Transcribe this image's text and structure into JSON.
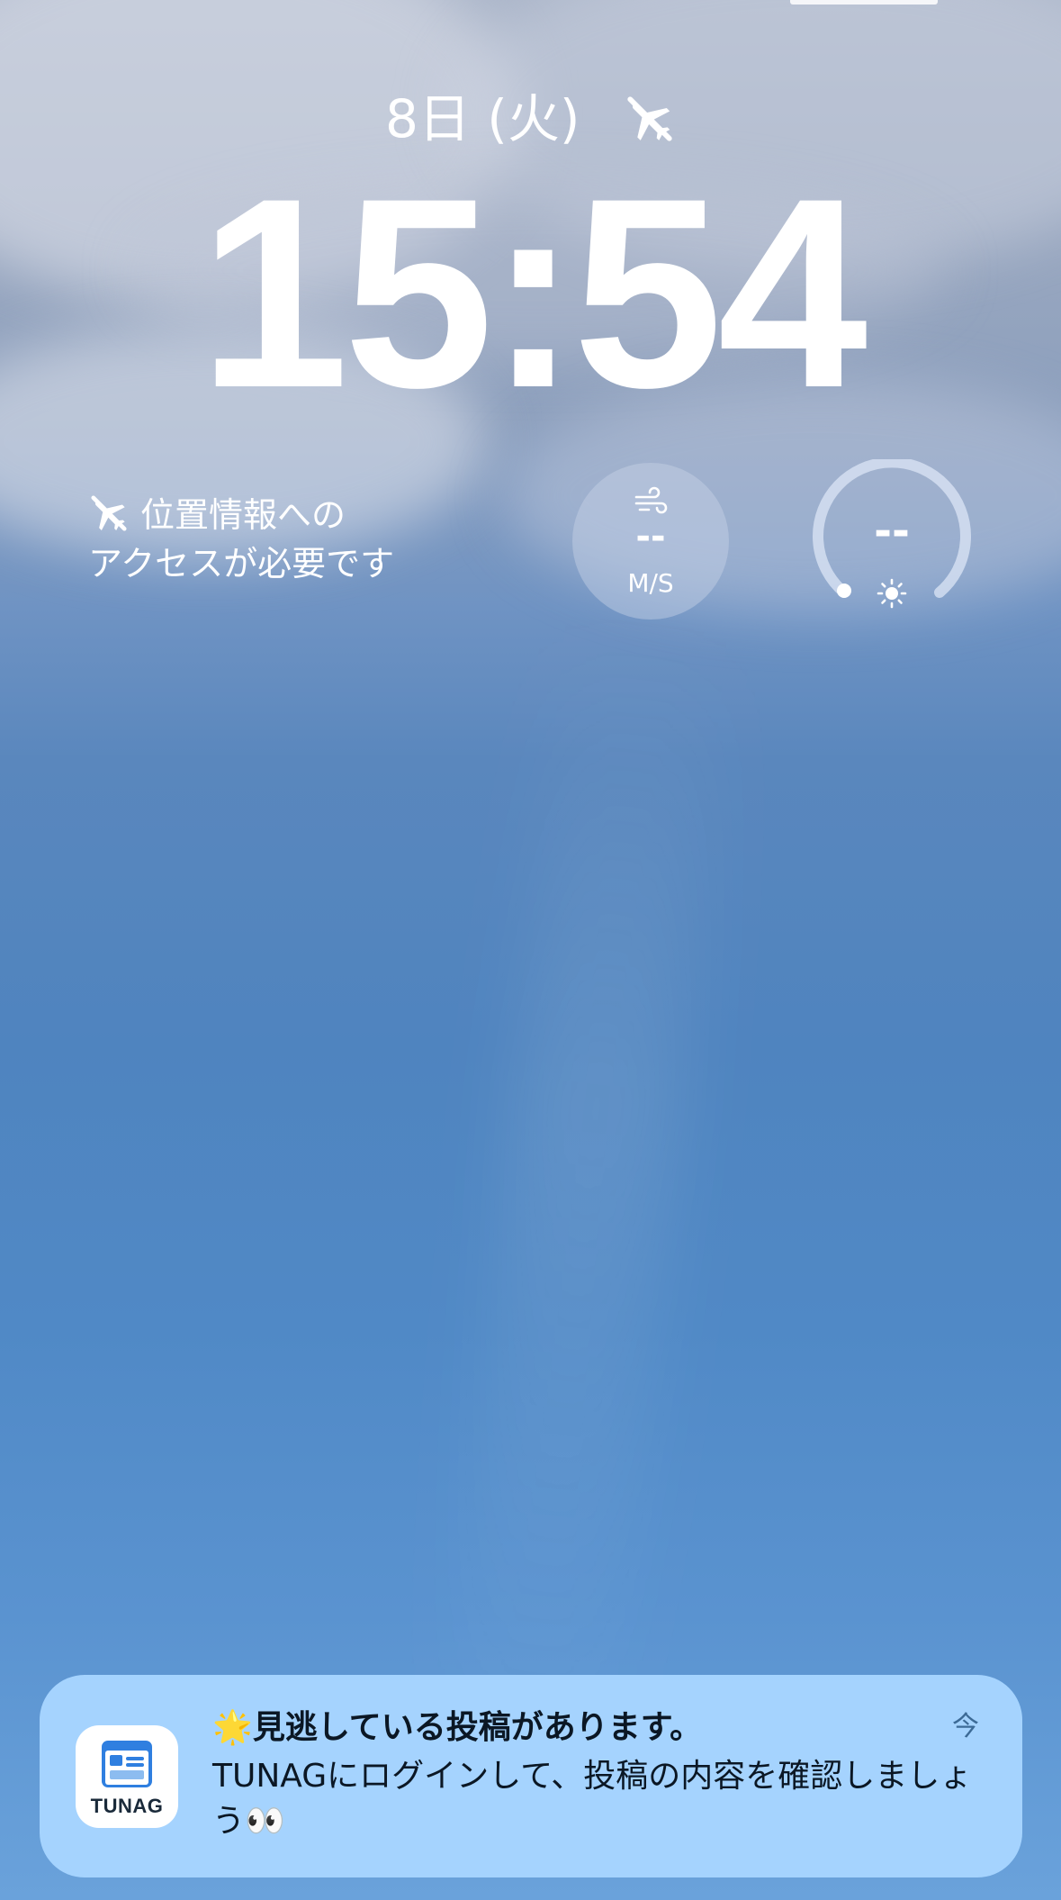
{
  "status": {
    "date": "8日 (火)",
    "date_icon": "airplane-off-icon"
  },
  "clock": {
    "time": "15:54"
  },
  "widgets": {
    "location": {
      "icon": "airplane-off-icon",
      "line1": "位置情報への",
      "line2": "アクセスが必要です"
    },
    "wind": {
      "icon": "wind-icon",
      "value": "--",
      "unit": "M/S"
    },
    "uv": {
      "value": "--",
      "icon": "sun-icon"
    }
  },
  "notification": {
    "app_name": "TUNAG",
    "title": "🌟見逃している投稿があります。",
    "body": "TUNAGにログインして、投稿の内容を確認しましょう👀",
    "time": "今",
    "colors": {
      "background": "#a8d5ff",
      "app_icon_accent": "#2f7fe0"
    }
  }
}
